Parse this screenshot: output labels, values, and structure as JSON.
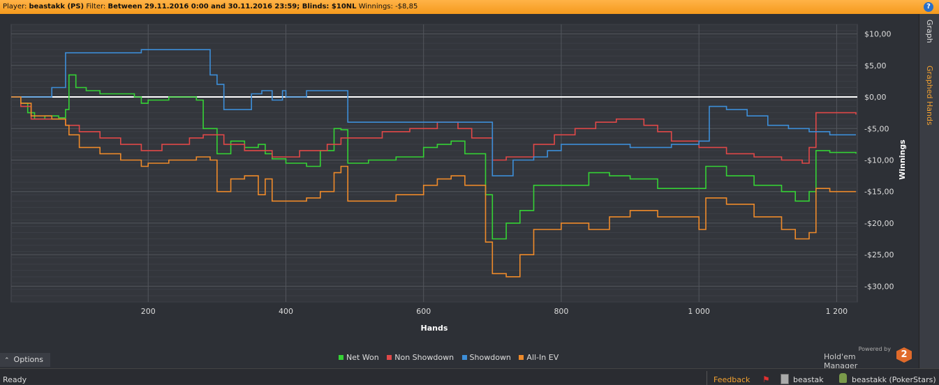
{
  "header": {
    "player_label": "Player:",
    "player": "beastakk (PS)",
    "filter_label": "Filter:",
    "filter": "Between 29.11.2016 0:00 and 30.11.2016 23:59; Blinds: $10NL",
    "winnings_label": "Winnings:",
    "winnings": "-$8,85",
    "help_icon": "?"
  },
  "side_tabs": {
    "graph": "Graph",
    "graphed_hands": "Graphed Hands"
  },
  "options_label": "Options",
  "powered_by": {
    "line1": "Powered by",
    "line2": "Hold'em Manager",
    "badge": "2"
  },
  "status": {
    "ready": "Ready",
    "feedback": "Feedback",
    "user": "beastak",
    "account": "beastakk (PokerStars)"
  },
  "colors": {
    "net_won": "#35d235",
    "non_showdown": "#e04848",
    "showdown": "#3d8ed8",
    "allin_ev": "#ee8a2a",
    "accent": "#f0a030"
  },
  "chart_data": {
    "type": "line",
    "xlabel": "Hands",
    "ylabel": "Winnings",
    "xlim": [
      1,
      1230
    ],
    "ylim": [
      -32.5,
      11.5
    ],
    "xticks": [
      200,
      400,
      600,
      800,
      1000,
      1200
    ],
    "xtick_labels": [
      "200",
      "400",
      "600",
      "800",
      "1 000",
      "1 200"
    ],
    "yticks": [
      10,
      5,
      0,
      -5,
      -10,
      -15,
      -20,
      -25,
      -30
    ],
    "ytick_labels": [
      "$10,00",
      "$5,00",
      "$0,00",
      "-$5,00",
      "-$10,00",
      "-$15,00",
      "-$20,00",
      "-$25,00",
      "-$30,00"
    ],
    "grid": true,
    "legend": "bottom-center",
    "series": [
      {
        "name": "Net Won",
        "x": [
          1,
          15,
          25,
          35,
          50,
          70,
          80,
          85,
          95,
          110,
          130,
          160,
          180,
          190,
          200,
          230,
          270,
          280,
          300,
          320,
          340,
          360,
          370,
          380,
          400,
          430,
          450,
          470,
          480,
          490,
          520,
          560,
          600,
          620,
          640,
          660,
          690,
          700,
          720,
          740,
          760,
          800,
          840,
          870,
          900,
          940,
          1000,
          1010,
          1040,
          1080,
          1120,
          1140,
          1160,
          1170,
          1190,
          1228
        ],
        "values": [
          0,
          -1,
          -2.5,
          -3.5,
          -3,
          -3.3,
          -2,
          3.5,
          1.5,
          1,
          0.5,
          0.5,
          0,
          -1,
          -0.5,
          0,
          -0.5,
          -5,
          -9,
          -7,
          -8,
          -7.5,
          -9,
          -9.8,
          -10.5,
          -11,
          -8.5,
          -5,
          -5.2,
          -10.5,
          -10,
          -9.5,
          -8,
          -7.5,
          -7,
          -9,
          -15.5,
          -22.5,
          -20,
          -18,
          -14,
          -14,
          -12,
          -12.5,
          -13,
          -14.5,
          -14.5,
          -11,
          -12.5,
          -14,
          -15,
          -16.5,
          -15,
          -8.5,
          -8.8,
          -9
        ]
      },
      {
        "name": "Non Showdown",
        "x": [
          1,
          15,
          30,
          60,
          80,
          100,
          130,
          160,
          190,
          220,
          260,
          280,
          310,
          340,
          380,
          420,
          460,
          480,
          500,
          540,
          580,
          620,
          650,
          670,
          700,
          720,
          760,
          790,
          820,
          850,
          880,
          920,
          940,
          960,
          1000,
          1040,
          1080,
          1120,
          1150,
          1160,
          1170,
          1228
        ],
        "values": [
          0,
          -1.5,
          -3.5,
          -3.5,
          -4.5,
          -5.5,
          -6.5,
          -7.5,
          -8.5,
          -7.5,
          -6.5,
          -6,
          -7.5,
          -8.5,
          -9.5,
          -8.5,
          -7.5,
          -6.5,
          -6.5,
          -5.5,
          -5,
          -4,
          -5,
          -6.5,
          -10,
          -9.5,
          -7.5,
          -6,
          -5,
          -4,
          -3.5,
          -4.5,
          -5.5,
          -7,
          -8,
          -9,
          -9.5,
          -10,
          -10.5,
          -8,
          -2.5,
          -2.8
        ]
      },
      {
        "name": "Showdown",
        "x": [
          1,
          50,
          60,
          80,
          100,
          140,
          160,
          190,
          220,
          270,
          290,
          300,
          310,
          350,
          365,
          380,
          395,
          400,
          420,
          430,
          480,
          490,
          520,
          600,
          690,
          700,
          730,
          760,
          780,
          800,
          900,
          960,
          1000,
          1015,
          1040,
          1070,
          1100,
          1130,
          1160,
          1190,
          1228
        ],
        "values": [
          0,
          0,
          1.5,
          7,
          7,
          7,
          7,
          7.5,
          7.5,
          7.5,
          3.5,
          2,
          -2,
          0.5,
          1,
          -0.5,
          1,
          0,
          0,
          1,
          1,
          -4,
          -4,
          -4,
          -4,
          -12.5,
          -10,
          -9.5,
          -8.5,
          -7.5,
          -8,
          -7.5,
          -7,
          -1.5,
          -2,
          -3,
          -4.5,
          -5,
          -5.5,
          -6,
          -6
        ]
      },
      {
        "name": "All-In EV",
        "x": [
          1,
          15,
          30,
          60,
          80,
          85,
          100,
          130,
          160,
          190,
          200,
          230,
          270,
          290,
          300,
          320,
          340,
          360,
          370,
          380,
          400,
          430,
          450,
          470,
          480,
          490,
          520,
          560,
          600,
          620,
          640,
          660,
          690,
          700,
          720,
          740,
          760,
          800,
          840,
          870,
          900,
          940,
          1000,
          1010,
          1040,
          1080,
          1120,
          1140,
          1160,
          1170,
          1190,
          1228
        ],
        "values": [
          0,
          -1,
          -3,
          -3.5,
          -4.5,
          -6,
          -8,
          -9,
          -10,
          -11,
          -10.5,
          -10,
          -9.5,
          -10,
          -15,
          -13,
          -12.5,
          -15.5,
          -13,
          -16.5,
          -16.5,
          -16,
          -15,
          -12,
          -11,
          -16.5,
          -16.5,
          -15.5,
          -14,
          -13,
          -12.5,
          -14,
          -23,
          -28,
          -28.5,
          -25,
          -21,
          -20,
          -21,
          -19,
          -18,
          -19,
          -21,
          -16,
          -17,
          -19,
          -21,
          -22.5,
          -21.5,
          -14.5,
          -15,
          -15
        ]
      }
    ]
  }
}
